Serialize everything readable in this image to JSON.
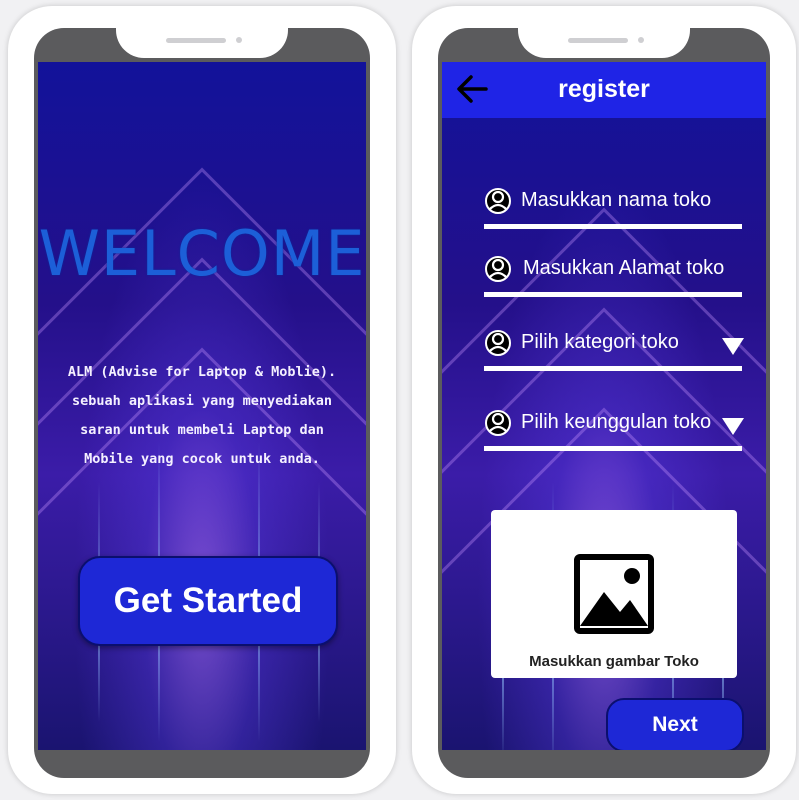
{
  "welcome_screen": {
    "title": "WELCOME",
    "description_lines": [
      "ALM (Advise for Laptop & Moblie).",
      "sebuah aplikasi yang menyediakan",
      "saran untuk membeli Laptop dan",
      "Mobile yang cocok untuk anda."
    ],
    "button_label": "Get Started"
  },
  "register_screen": {
    "title": "register",
    "back_icon": "arrow-left-icon",
    "fields": [
      {
        "label": "Masukkan nama toko",
        "icon": "user-icon",
        "dropdown": false
      },
      {
        "label": "Masukkan Alamat toko",
        "icon": "user-icon",
        "dropdown": false
      },
      {
        "label": "Pilih kategori toko",
        "icon": "user-icon",
        "dropdown": true
      },
      {
        "label": "Pilih keunggulan toko",
        "icon": "user-icon",
        "dropdown": true
      }
    ],
    "image_upload_label": "Masukkan gambar Toko",
    "image_icon": "image-icon",
    "next_label": "Next"
  },
  "colors": {
    "primary": "#1f24e6",
    "welcome_text": "#1c5fd8",
    "background_dark": "#12129a"
  }
}
